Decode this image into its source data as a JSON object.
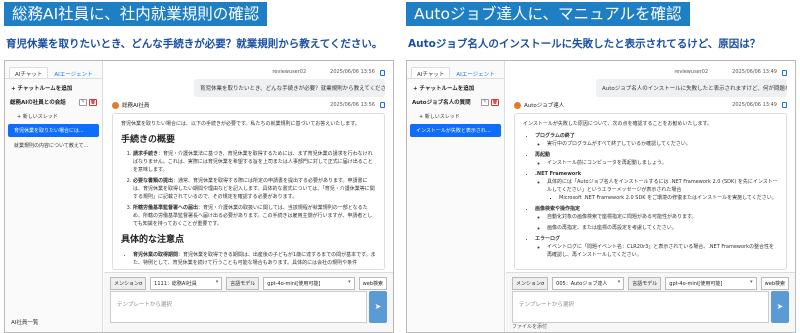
{
  "left": {
    "banner": "総務AI社員に、社内就業規則の確認",
    "question": "育児休業を取りたいとき、どんな手続きが必要？就業規則から教えてください。",
    "tabs": [
      "AIチャット",
      "AIエージェント"
    ],
    "add_chat": "+ チャットルームを追加",
    "conversation": "総務AIの社員との会話",
    "new_thread": "+ 新しいスレッド",
    "threads": [
      "育児休業を取りたい場合には...",
      "就業規則の内容について教えて..."
    ],
    "user": "reviewuser02",
    "user_time": "2025/06/06 13:56",
    "user_msg": "育児休業を取りたいとき、どんな手続きが必要？就業規則から教えてください。",
    "bot_name": "総務AI社員",
    "bot_time": "2025/06/06 13:56",
    "intro": "育児休業を取りたい場合には、以下の手続きが必要です。私たちの就業規則に基づいてお答えいたします。",
    "h1": "手続きの概要",
    "steps": [
      {
        "title": "請求手続き",
        "text": "育児・介護休業法に基づき、育児休業を取得するためには、まず育児休業の請求を行わなければなりません。これは、実際には育児休業を希望する旨を上司または人事部門に対して正式に届け出ることを意味します。"
      },
      {
        "title": "必要な書類の提出",
        "text": "通常、育児休業を取得する際には所定の申請書を提出する必要があります。申請書には、育児休業を取得したい期間や理由などを記入します。具体的な書式については、「育児・介護休業等に関する規則」に記載されているので、その規定を確認する必要があります。"
      },
      {
        "title": "所轄労働基準監督署への届出",
        "text": "育児・介護休業の取扱いに関しては、当該規程が就業規則の一部となるため、所轄の労働基準監督署長へ届け出る必要があります。この手続きは雇用主側が行いますが、申請者としても知識を持っておくことが重要です。"
      }
    ],
    "h2": "具体的な注意点",
    "note": {
      "title": "育児休業の取得期間",
      "text": "育児休業を取得できる期間は、出産後の子どもが1歳に達するまでの間が基本です。また、特例として、育児休業を続けて行うことも可能な場合もあります。具体的には会社の規則や条件"
    },
    "ctl_mention": "メンションσ",
    "mention_value": "1111：総務AI社員",
    "ctl_lang": "言語モデル",
    "model_value": "gpt-4o-mini[使用可能]",
    "web": "web検索",
    "placeholder": "テンプレートから選択",
    "send": "➤",
    "footer": "AI社員一覧"
  },
  "right": {
    "banner": "Autoジョブ達人に、マニュアルを確認",
    "question": "Autoジョブ名人のインストールに失敗したと表示されてるけど、原因は？",
    "tabs": [
      "AIチャット",
      "AIエージェント"
    ],
    "add_chat": "+ チャットルームを追加",
    "conversation": "Autoジョブ名人の質問",
    "new_thread": "+ 新しいスレッド",
    "threads": [
      "インストールが失敗と表示されている..."
    ],
    "user": "reviewuser02",
    "user_time": "2025/06/06 13:49",
    "user_msg": "Autoジョブ名人のインストールに失敗したと表示されますけど、何が問題なんだろう？",
    "bot_name": "Autoジョブ達人",
    "bot_time": "2025/06/06 13:49",
    "intro": "インストールが失敗した原因について、次の点を確認することをお勧めいたします。",
    "items": [
      {
        "title": "プログラムの終了",
        "subs": [
          "実行中のプログラムがすべて終了しているか確認してください。"
        ]
      },
      {
        "title": "再起動",
        "subs": [
          "インストール前にコンピュータを再起動しましょう。"
        ]
      },
      {
        "title": ".NET Framework",
        "subs": [
          "具体的には「Autoジョブ名人をインストールするには .NET Framework 2.0 (SDK) を先にインストールしてください」というエラーメッセージが表示された場合"
        ],
        "subs2": [
          "Microsoft .NET Framework 2.0 SDK をご環境の修復またはインストールを実施してください。"
        ]
      },
      {
        "title": "画像検索や操作指定",
        "subs": [
          "自動化対象の画像検索で座標指定に問題がある可能性があります。",
          "画像の再指定、または座標の再設定を考慮してください。"
        ]
      },
      {
        "title": "エラーログ",
        "subs": [
          "イベントログに「問題イベント名：CLR20r3」と表示されている場合、.NET Frameworkの整合性を再確認し、再インストールしてください。"
        ]
      }
    ],
    "ctl_mention": "メンションσ",
    "mention_value": "005：Autoジョブ達人",
    "ctl_lang": "言語モデル",
    "model_value": "gpt-4o-mini[使用可能]",
    "web": "web検索",
    "placeholder": "テンプレートから選択",
    "send": "➤",
    "footer": "ファイルを添付"
  }
}
